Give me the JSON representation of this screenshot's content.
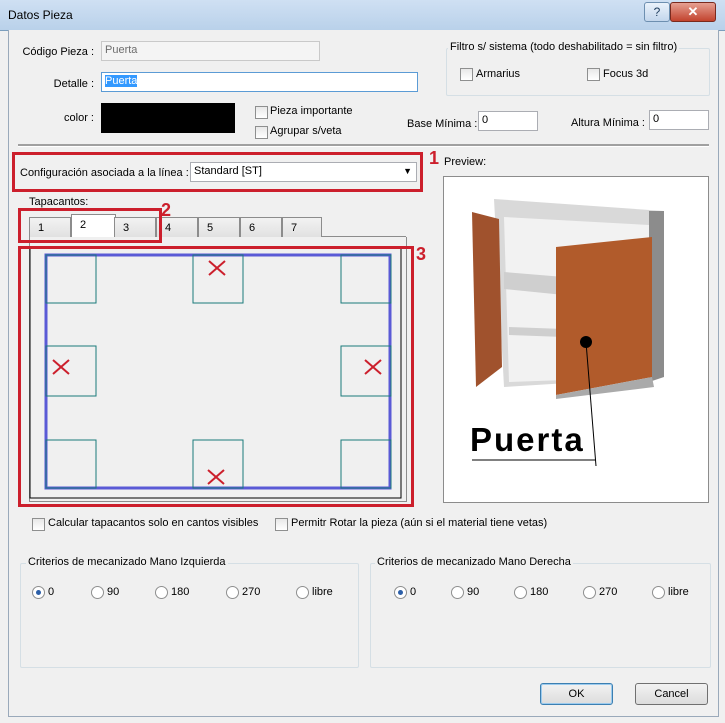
{
  "window": {
    "title": "Datos Pieza",
    "help": "?",
    "close": "✕"
  },
  "fields": {
    "codigo_label": "Código Pieza :",
    "codigo_value": "Puerta",
    "detalle_label": "Detalle :",
    "detalle_value": "Puerta",
    "color_label": "color :",
    "color_value": "#000000",
    "pieza_importante": "Pieza importante",
    "agrupar": "Agrupar s/veta",
    "base_label": "Base Mínima :",
    "base_value": "0",
    "altura_label": "Altura Mínima :",
    "altura_value": "0"
  },
  "filtro": {
    "title": "Filtro s/ sistema (todo deshabilitado = sin filtro)",
    "armarius": "Armarius",
    "focus": "Focus 3d"
  },
  "config": {
    "label": "Configuración asociada a la línea :",
    "value": "Standard [ST]"
  },
  "tapacantos": {
    "label": "Tapacantos:",
    "tabs": [
      "1",
      "2",
      "3",
      "4",
      "5",
      "6",
      "7"
    ],
    "selected": "2"
  },
  "preview": {
    "label": "Preview:",
    "text": "Puerta"
  },
  "checks": {
    "calcular": "Calcular tapacantos solo en cantos visibles",
    "permitir": "Permitr Rotar la pieza (aún si el material tiene vetas)"
  },
  "izquierda": {
    "title": "Criterios de mecanizado Mano Izquierda",
    "options": [
      "0",
      "90",
      "180",
      "270",
      "libre"
    ],
    "selected": "0"
  },
  "derecha": {
    "title": "Criterios de mecanizado Mano Derecha",
    "options": [
      "0",
      "90",
      "180",
      "270",
      "libre"
    ],
    "selected": "0"
  },
  "buttons": {
    "ok": "OK",
    "cancel": "Cancel"
  },
  "annotations": [
    "1",
    "2",
    "3"
  ],
  "colors": {
    "annotation": "#cc1f2c",
    "edge": "#5a5ad6",
    "panel": "#1a7a7a",
    "door": "#a0522d"
  }
}
